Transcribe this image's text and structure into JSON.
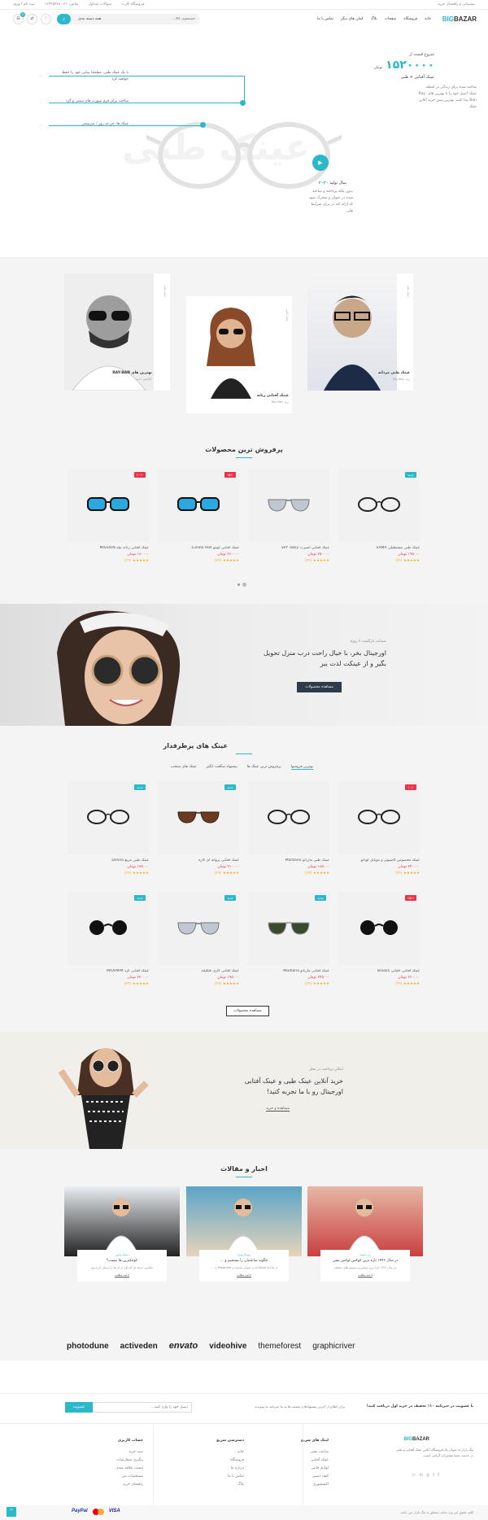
{
  "topbar": {
    "right_text": "پشتیبانی و راهنمای خرید",
    "links": [
      "فروشگاه کارت",
      "سوالات متداول",
      "تماس: ۰۲۱-۱۲۳۴۵۶۷۸",
      "ثبت نام / ورود"
    ]
  },
  "header": {
    "logo_big": "BIG",
    "logo_bazar": "BAZAR",
    "nav": [
      "خانه",
      "فروشگاه",
      "صفحات",
      "بلاگ",
      "کمان های دیگر",
      "تماس با ما"
    ],
    "search_placeholder": "جستجوی کالا...",
    "category_label": "همه دسته بندی",
    "cart_count": "0"
  },
  "hero": {
    "starting_price_label": "شروع قیمت از",
    "price": "۱۵۲۰۰۰۰",
    "currency": "تومان",
    "subtitle": "عینک آفتابی + طبی",
    "desc": "ساخته شده برای زندگی در لحظه. عینک اصیل خود را با بهترین های Ray-Ban پیدا کنید. بهترین پیش خرید آنلاین عینک",
    "watermark": "عینک طبی",
    "callouts": [
      "با یک عینک طبی، مطمئنا بینایی خود را حفظ خواهید کرد",
      "ساخت برای فرم صورت های سنتی و گرد",
      "عینک ها، جز مد روز / ضریبنمی"
    ],
    "year_label": "سال تولید",
    "year": "۲۰۲۰",
    "year_desc": "بدون بلکه پرداخته و ساخته شده در عنوان و متحرک شود که ارائه کند در برای شرایط هلی."
  },
  "models": {
    "cards": [
      {
        "title": "عینک طبی مردانه",
        "sub": "برند Ray-Ban"
      },
      {
        "title": "عینک آفتابی زنانه",
        "sub": "برند Ray-Ban"
      },
      {
        "title": "بهترین های RAY-BAN",
        "sub": "کالکشن جدید"
      }
    ],
    "vertical_labels": [
      "عینک طبی",
      "عینک آفتابی",
      "عینک طبی"
    ]
  },
  "bestsellers": {
    "title": "پرفروش ترین محصولات",
    "items": [
      {
        "name": "عینک طبی مستطیلی SAMA",
        "price": "۱۹۵۰۰۰ تومان",
        "badge": "جدید",
        "badge_color": "#2bb8c8"
      },
      {
        "name": "عینک آفتابی اسپرت SPY Tobiy",
        "price": "۲۵۰۰۰۰ تومان",
        "badge": "",
        "badge_color": ""
      },
      {
        "name": "عینک آفتابی لونتو Lunelo Holl",
        "price": "۲۶۰۰۰۰ تومان",
        "badge": "-۱۵٪",
        "badge_color": "#e9334a"
      },
      {
        "name": "عینک آفتابی زنانه نیله MISSION",
        "price": "۱۸۰۰۰۰ تومان",
        "badge": "-۲۰٪",
        "badge_color": "#e9334a"
      }
    ],
    "stars": "★★★★★ (۲۴)"
  },
  "promo": {
    "kicker": "ضمانت بازگشت ۷ روزه",
    "title1": "اورجینال بخر، با خیال راحت درب منزل تحویل",
    "title2": "بگیر و از عینکت لذت ببر",
    "button": "مشاهده محصولات"
  },
  "popular": {
    "title": "عینک های پرطرفدار",
    "tabs": [
      "بهترین فروشها",
      "پرفروش ترین عینک ها",
      "پیشنهاد شگفت انگیز",
      "عینک های منتخب"
    ],
    "row1": [
      {
        "name": "عینک مخصوص کامپیوتر و موبایل لونانو",
        "price": "۲۴۰۰۰۰ تومان",
        "badge": "-۱۰٪",
        "badge_color": "#e9334a"
      },
      {
        "name": "عینک طبی ماربانو Marbano",
        "price": "۱۸۵۰۰۰ تومان",
        "badge": "",
        "badge_color": ""
      },
      {
        "name": "عینک آفتابی پروانه ای کاره",
        "price": "۲۱۰۰۰۰ تومان",
        "badge": "جدید",
        "badge_color": "#2bb8c8"
      },
      {
        "name": "عینک طبی مربع Donna",
        "price": "۱۷۵۰۰۰ تومان",
        "badge": "جدید",
        "badge_color": "#2bb8c8"
      }
    ],
    "row2": [
      {
        "name": "عینک آفتابی خلبانی Brooks",
        "price": "۲۶۰۰۰۰ تومان",
        "badge": "-۲۵٪",
        "badge_color": "#e9334a"
      },
      {
        "name": "عینک آفتابی ماربانو Marbano",
        "price": "۲۴۵۰۰۰ تومان",
        "badge": "جدید",
        "badge_color": "#2bb8c8"
      },
      {
        "name": "عینک آفتابی کاری فلگپلند",
        "price": "۱۹۵۰۰۰ تومان",
        "badge": "جدید",
        "badge_color": "#2bb8c8"
      },
      {
        "name": "عینک آفتابی گرد MAXIMIM",
        "price": "۲۲۰۰۰۰ تومان",
        "badge": "جدید",
        "badge_color": "#2bb8c8"
      }
    ],
    "more_button": "مشاهده محصولات"
  },
  "promo2": {
    "kicker": "امکان پرداخت در محل",
    "title1": "خرید آنلاین عینک طبی و عینک آفتابی",
    "title2": "اورجینال رو با ما تجربه کنید!",
    "link": "مشاهده و خرید"
  },
  "news": {
    "title": "اخبار و مقالات",
    "items": [
      {
        "cat": "بی دسته",
        "title": "در سال ۱۴۴۶ تازه ترین کوکس لوکس بسی",
        "excerpt": "در سال ۱۴۴۶ تازه ترین لوکس و سیستم های مختلف",
        "more": "ادامه مطلب"
      },
      {
        "cat": "رویداد ویژه",
        "title": "چگونه ساعتمان را بسنجیم و ...",
        "excerpt": "از Muse & Co که به عنوان نماینده ی Pessimist را ...",
        "more": "ادامه مطلب"
      },
      {
        "cat": "مجله مدور",
        "title": "کوچکترین ها بیست؟",
        "excerpt": "عکاسی حرفه ای که یکی از آن ها را ارسال کرده بود",
        "more": "ادامه مطلب"
      }
    ]
  },
  "brands": [
    "photodune",
    "activeden",
    "envato",
    "videohive",
    "themeforest",
    "graphicriver"
  ],
  "newsletter": {
    "title": "با عضویت در خبرنامه ۱۰٪ تخفیف در خرید اول دریافت کنید!",
    "desc": "برای اطلاع از آخرین پیشنهادها و تخفیف ها به ما خبرنامه ما بپیوندید",
    "placeholder": "ایمیل خود را وارد کنید...",
    "button": "عضویت"
  },
  "footer": {
    "about": "بیگ بازار به عنوان یک فروشگاه آنلاین عینک آفتابی و طبی در خدمت شما مشتریان گرامی است.",
    "col1_title": "لینک های سریع",
    "col1": [
      "ساعت مچی",
      "عینک آفتابی",
      "لوازم جانبی",
      "کیف دستی",
      "اکسسوری"
    ],
    "col2_title": "حساب کاربری",
    "col2": [
      "سبد خرید",
      "پیگیری سفارشات",
      "لیست علاقه مندی",
      "مشخصات من",
      "راهنمای خرید"
    ],
    "col3_title": "دسترسی سریع",
    "col3": [
      "خانه",
      "فروشگاه",
      "درباره ما",
      "تماس با ما",
      "بلاگ"
    ],
    "copyright": "کلیه حقوق این وب سایت متعلق به بیگ بازار می باشد.",
    "payments": [
      "PayPal",
      "VISA"
    ]
  },
  "colors": {
    "accent": "#2bb8c8",
    "sale": "#e9334a",
    "dark": "#2f3a4b"
  }
}
